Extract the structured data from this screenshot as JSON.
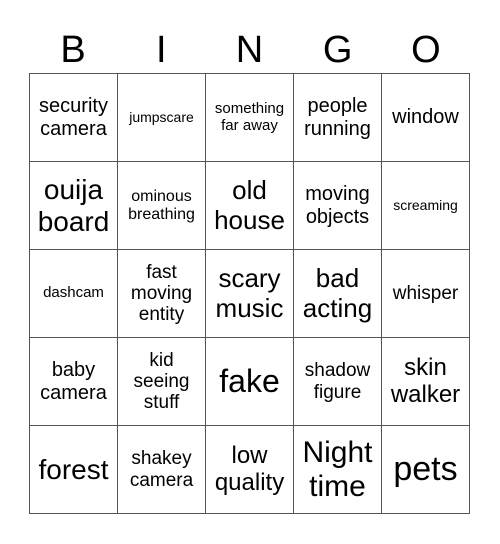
{
  "header": [
    "B",
    "I",
    "N",
    "G",
    "O"
  ],
  "cells": [
    [
      "security camera",
      "jumpscare",
      "something far away",
      "people running",
      "window"
    ],
    [
      "ouija board",
      "ominous breathing",
      "old house",
      "moving objects",
      "screaming"
    ],
    [
      "dashcam",
      "fast moving entity",
      "scary music",
      "bad acting",
      "whisper"
    ],
    [
      "baby camera",
      "kid seeing stuff",
      "fake",
      "shadow figure",
      "skin walker"
    ],
    [
      "forest",
      "shakey camera",
      "low quality",
      "Night time",
      "pets"
    ]
  ]
}
